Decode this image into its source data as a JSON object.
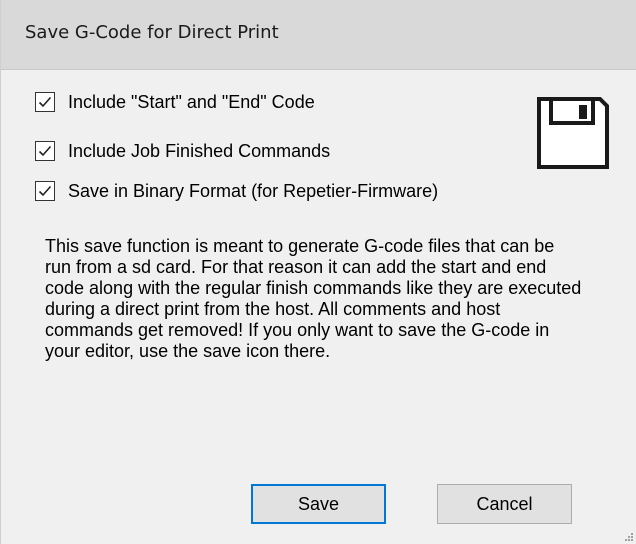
{
  "window": {
    "title": "Save G-Code for Direct Print"
  },
  "options": [
    {
      "label": "Include \"Start\" and \"End\" Code",
      "checked": true
    },
    {
      "label": "Include Job Finished Commands",
      "checked": true
    },
    {
      "label": "Save in Binary Format (for Repetier-Firmware)",
      "checked": true
    }
  ],
  "description": {
    "lines": [
      "This save function is meant to generate G-code files that can be",
      "run from a sd card. For that reason it can add the start and end",
      "code along with the regular finish commands like they are executed",
      "during a direct print from the host. All comments and host",
      "commands get removed! If you only want to save the G-code in",
      "your editor, use the save icon there."
    ]
  },
  "buttons": {
    "save_label": "Save",
    "cancel_label": "Cancel"
  },
  "icons": {
    "save": "floppy-disk-icon",
    "check": "checkmark-icon",
    "resize": "resize-grip-icon"
  },
  "colors": {
    "title_bar": "#d9d9d9",
    "dialog_background": "#f0f0f0",
    "default_button_border": "#0078d7",
    "button_face": "#e1e1e1"
  }
}
